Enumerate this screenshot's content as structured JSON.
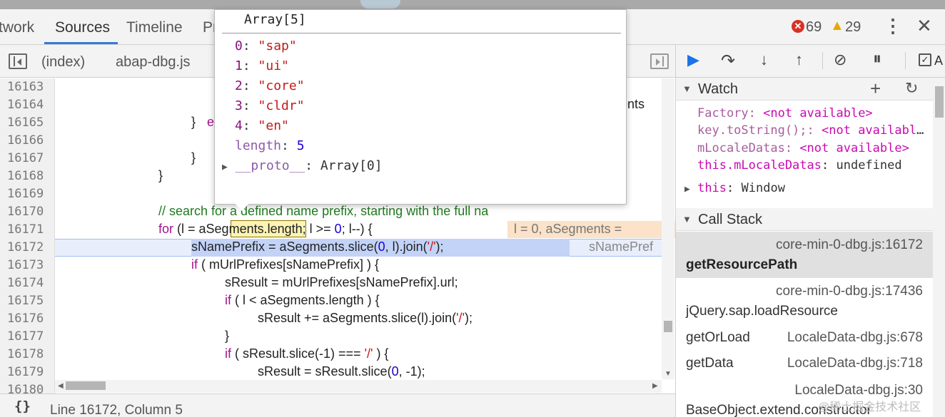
{
  "tabs": {
    "network": "twork",
    "sources": "Sources",
    "timeline": "Timeline",
    "profiles": "Pr"
  },
  "status": {
    "errors": "69",
    "warnings": "29"
  },
  "file_tabs": [
    "(index)",
    "abap-dbg.js"
  ],
  "editor": {
    "line_numbers": [
      "16163",
      "16164",
      "16165",
      "16166",
      "16167",
      "16168",
      "16169",
      "16170",
      "16171",
      "16172",
      "16173",
      "16174",
      "16175",
      "16176",
      "16177",
      "16178",
      "16179",
      "16180"
    ],
    "clipped_ents": "ents",
    "l16165_brace": "}",
    "l16165_e": "e",
    "l16167_brace": "}",
    "l16168_brace": "}",
    "l16170_comment": "// search for a defined name prefix, starting with the full na",
    "l16171_for": "for",
    "l16171_a": " (l = ",
    "l16171_token": "aSegments",
    "l16171_b": ".length; l >= ",
    "l16171_zero": "0",
    "l16171_c": "; l--) {",
    "l16171_inline": "l = 0, aSegments = ",
    "l16172_a": "sNamePrefix = aSegments.slice(",
    "l16172_zero": "0",
    "l16172_b": ", l).join(",
    "l16172_str": "'/'",
    "l16172_c": ");",
    "l16172_inline": "sNamePref",
    "l16173_if": "if",
    "l16173_rest": " ( mUrlPrefixes[sNamePrefix] ) {",
    "l16174": "sResult = mUrlPrefixes[sNamePrefix].url;",
    "l16175_if": "if",
    "l16175_rest": " ( l < aSegments.length ) {",
    "l16176_a": "sResult += aSegments.slice(l).join(",
    "l16176_str": "'/'",
    "l16176_b": ");",
    "l16177": "}",
    "l16178_if": "if",
    "l16178_a": " ( sResult.slice(-1) === ",
    "l16178_str": "'/'",
    "l16178_b": " ) {",
    "l16179_a": "sResult = sResult.slice(",
    "l16179_zero": "0",
    "l16179_b": ", -1);"
  },
  "statusbar": {
    "pretty_icon": "{}",
    "position": "Line 16172, Column 5"
  },
  "popover": {
    "title": "Array[5]",
    "items": [
      {
        "key": "0",
        "value": "\"sap\""
      },
      {
        "key": "1",
        "value": "\"ui\""
      },
      {
        "key": "2",
        "value": "\"core\""
      },
      {
        "key": "3",
        "value": "\"cldr\""
      },
      {
        "key": "4",
        "value": "\"en\""
      }
    ],
    "length_key": "length",
    "length_value": "5",
    "proto_key": "__proto__",
    "proto_value": "Array[0]"
  },
  "watch": {
    "title": "Watch",
    "items": [
      {
        "name": "Factory",
        "value": "<not available>"
      },
      {
        "name": "key.toString();",
        "value": "<not available>"
      },
      {
        "name": "mLocaleDatas",
        "value": "<not available>"
      },
      {
        "name": "this.mLocaleDatas",
        "value": "undefined"
      }
    ],
    "this_name": "this",
    "this_value": "Window"
  },
  "callstack": {
    "title": "Call Stack",
    "frames": [
      {
        "fn": "getResourcePath",
        "loc": "core-min-0-dbg.js:16172"
      },
      {
        "fn": "jQuery.sap.loadResource",
        "loc": "core-min-0-dbg.js:17436"
      },
      {
        "fn": "getOrLoad",
        "loc": "LocaleData-dbg.js:678"
      },
      {
        "fn": "getData",
        "loc": "LocaleData-dbg.js:718"
      },
      {
        "fn": "BaseObject.extend.constructor",
        "loc": "LocaleData-dbg.js:30"
      }
    ]
  },
  "watermark": "@稀土掘金技术社区",
  "colors": {
    "accent": "#3879d9",
    "error": "#d93025",
    "warning": "#e6a700",
    "keyword": "#a1148e"
  }
}
